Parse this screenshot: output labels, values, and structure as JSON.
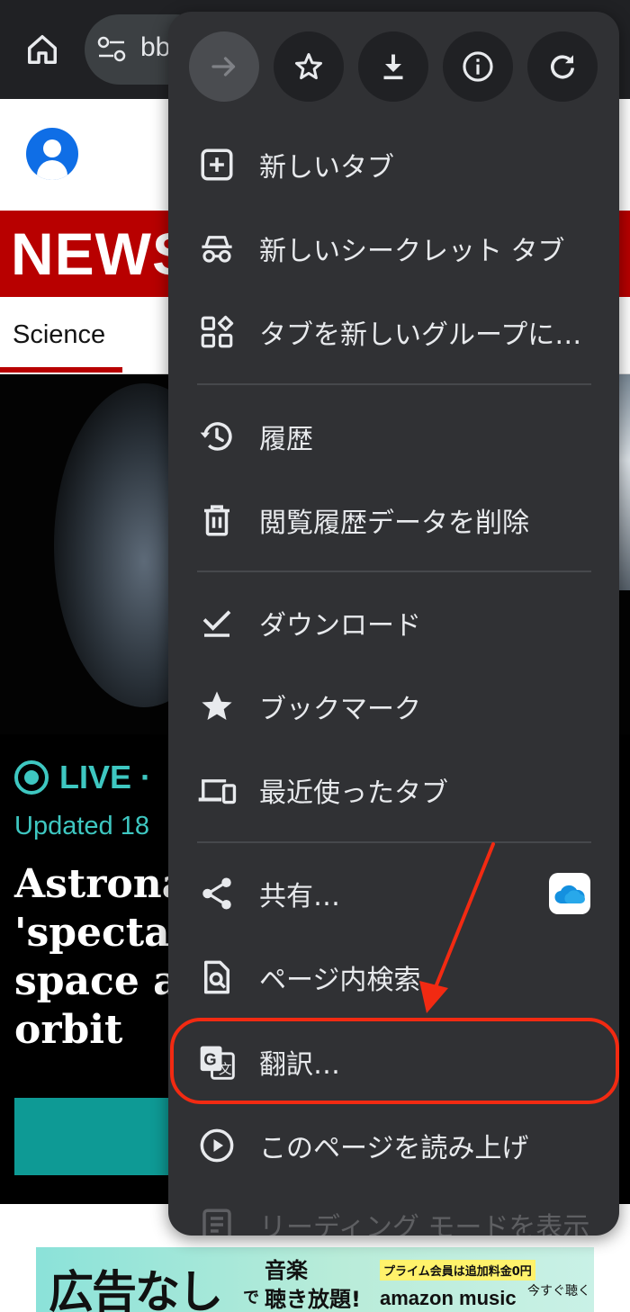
{
  "browser": {
    "url_partial": "bb"
  },
  "page": {
    "brand_word": "NEWS",
    "nav": {
      "active_tab": "Science"
    },
    "article": {
      "live_label": "LIVE ·",
      "updated": "Updated 18",
      "headline": "Astrona\n'spectac\nspace ar\norbit"
    },
    "ad": {
      "main": "広告なし",
      "de": "で",
      "line1": "音楽",
      "line2": "聴き放題!",
      "prime": "プライム会員は追加料金0円",
      "amazon": "amazon music",
      "cta": "今すぐ聴く"
    }
  },
  "menu": {
    "top_actions": [
      {
        "icon": "forward-icon",
        "enabled": false
      },
      {
        "icon": "star-icon",
        "enabled": true
      },
      {
        "icon": "download-icon",
        "enabled": true
      },
      {
        "icon": "info-icon",
        "enabled": true
      },
      {
        "icon": "refresh-icon",
        "enabled": true
      }
    ],
    "items": [
      {
        "id": "new-tab",
        "label": "新しいタブ",
        "icon": "plus-box-icon"
      },
      {
        "id": "new-incognito-tab",
        "label": "新しいシークレット タブ",
        "icon": "incognito-icon"
      },
      {
        "id": "tab-to-group",
        "label": "タブを新しいグループに…",
        "icon": "group-icon"
      },
      {
        "id": "history",
        "label": "履歴",
        "icon": "history-icon"
      },
      {
        "id": "clear-data",
        "label": "閲覧履歴データを削除",
        "icon": "trash-icon"
      },
      {
        "id": "downloads",
        "label": "ダウンロード",
        "icon": "download-check-icon"
      },
      {
        "id": "bookmarks",
        "label": "ブックマーク",
        "icon": "star-filled-icon"
      },
      {
        "id": "recent-tabs",
        "label": "最近使ったタブ",
        "icon": "devices-icon"
      },
      {
        "id": "share",
        "label": "共有…",
        "icon": "share-icon"
      },
      {
        "id": "find-in-page",
        "label": "ページ内検索",
        "icon": "find-in-page-icon"
      },
      {
        "id": "translate",
        "label": "翻訳…",
        "icon": "translate-icon"
      },
      {
        "id": "read-aloud",
        "label": "このページを読み上げ",
        "icon": "play-circle-icon"
      },
      {
        "id": "reading-mode",
        "label": "リーディング モードを表示",
        "icon": "reading-mode-icon"
      }
    ]
  },
  "annotation": {
    "color": "#f22a12",
    "target": "translate"
  }
}
